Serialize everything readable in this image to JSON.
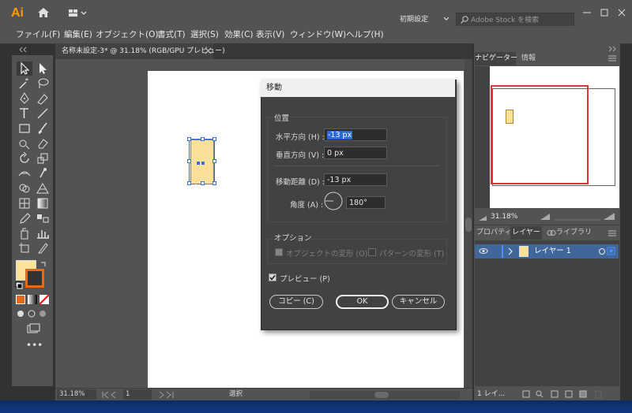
{
  "app": {
    "logo": "Ai",
    "workspace": "初期設定",
    "search_placeholder": "Adobe Stock を検索"
  },
  "menu": [
    "ファイル(F)",
    "編集(E)",
    "オブジェクト(O)",
    "書式(T)",
    "選択(S)",
    "効果(C)",
    "表示(V)",
    "ウィンドウ(W)",
    "ヘルプ(H)"
  ],
  "document": {
    "tab_title": "名称未設定-3* @ 31.18% (RGB/GPU プレビュー)",
    "zoom": "31.18%",
    "page": "1",
    "status": "選択"
  },
  "dialog": {
    "title": "移動",
    "position_label": "位置",
    "horizontal_label": "水平方向 (H) :",
    "horizontal_value": "-13 px",
    "vertical_label": "垂直方向 (V) :",
    "vertical_value": "0 px",
    "distance_label": "移動距離 (D) :",
    "distance_value": "-13 px",
    "angle_label": "角度 (A) :",
    "angle_value": "180°",
    "options_label": "オプション",
    "transform_objects": "オブジェクトの変形 (O)",
    "transform_patterns": "パターンの変形 (T)",
    "preview": "プレビュー (P)",
    "copy_button": "コピー (C)",
    "ok_button": "OK",
    "cancel_button": "キャンセル"
  },
  "panels": {
    "navigator_tab": "ナビゲーター",
    "info_tab": "情報",
    "nav_zoom": "31.18%",
    "properties_tab": "プロパティ",
    "layers_tab": "レイヤー",
    "libraries_tab": "ライブラリ",
    "layer_name": "レイヤー 1",
    "layer_count": "1 レイ..."
  },
  "colors": {
    "accent": "#2a6bd5",
    "fill": "#fbe09a",
    "stroke": "#e06b1c",
    "layer_row": "#40669a"
  }
}
